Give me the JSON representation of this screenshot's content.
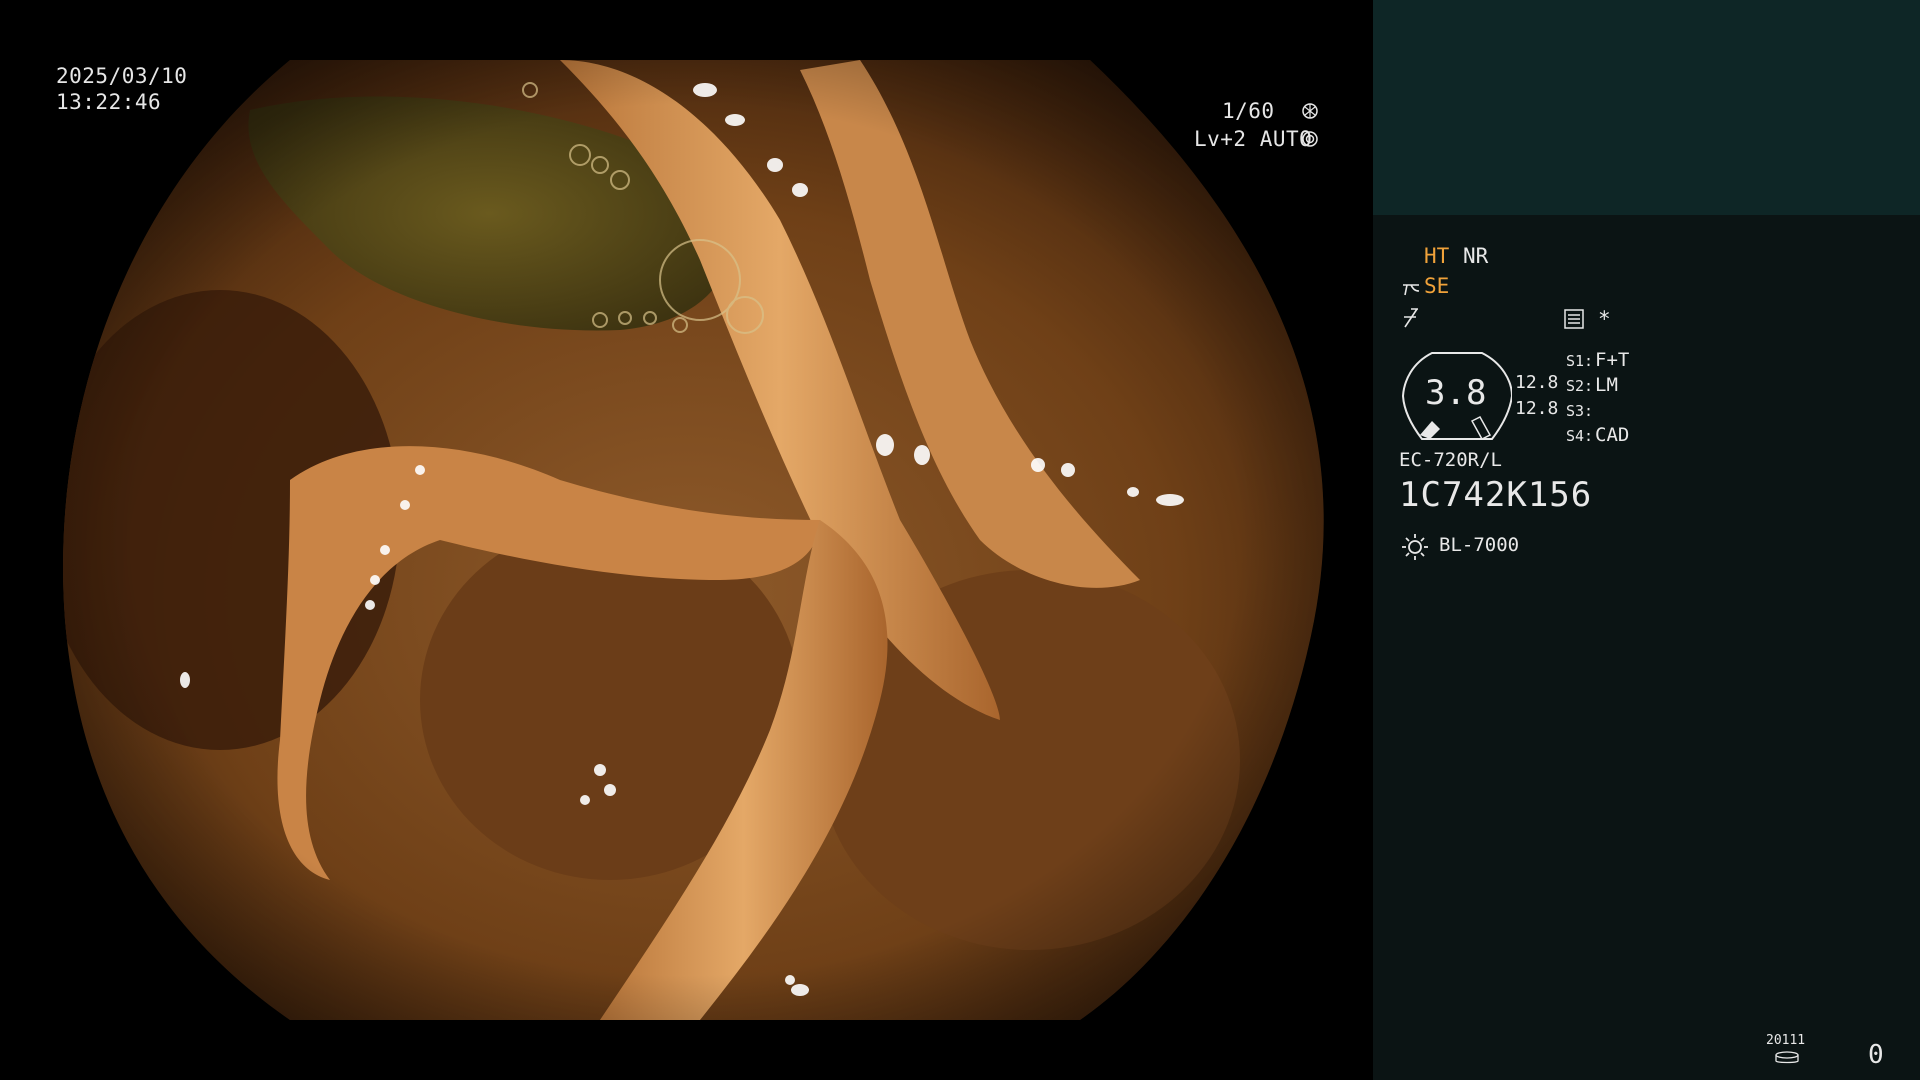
{
  "osd": {
    "date": "2025/03/10",
    "time": "13:22:46",
    "shutter": "1/60",
    "shutter_icon": "aperture-icon",
    "level": "Lv+2 AUTO",
    "level_icon": "iris-icon"
  },
  "panel": {
    "ht": "HT",
    "nr": "NR",
    "se": "SE",
    "se_icon": "scissors-icon",
    "tilde_icon": "slash-f-icon",
    "grid_icon": "menu-card-icon",
    "asterisk": "*",
    "zoom": "3.8",
    "val1": "12.8",
    "val2": "12.8",
    "s_labels": [
      "S1:",
      "S2:",
      "S3:",
      "S4:"
    ],
    "s_values": [
      "F+T",
      "LM",
      "",
      "CAD"
    ],
    "scope_model": "EC-720R/L",
    "serial": "1C742K156",
    "light_icon": "sun-icon",
    "light_source": "BL-7000",
    "storage_label": "20111",
    "storage_icon": "disk-icon",
    "counter": "0"
  },
  "colors": {
    "accent": "#f0a23a",
    "panel_top": "#0e2626",
    "panel": "#0b1414"
  }
}
